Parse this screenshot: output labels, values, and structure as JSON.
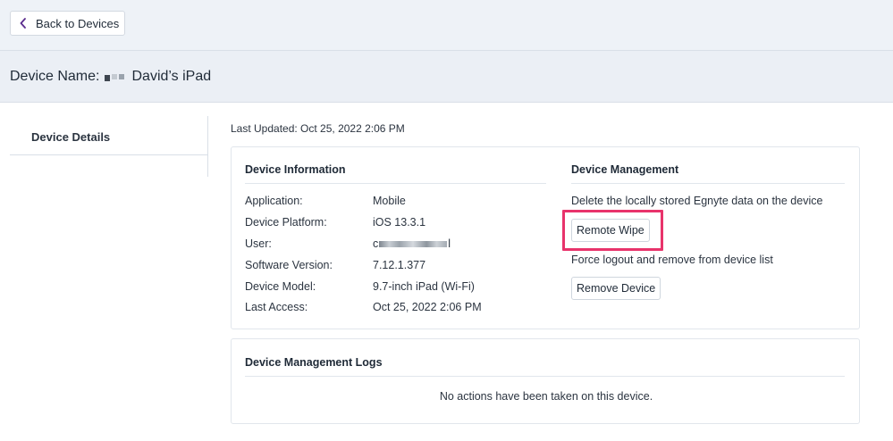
{
  "nav": {
    "back_label": "Back to Devices"
  },
  "header": {
    "device_name_label": "Device Name:",
    "device_name": "David’s iPad"
  },
  "sidebar": {
    "tabs": [
      {
        "label": "Device Details",
        "active": true
      }
    ]
  },
  "last_updated": "Last Updated: Oct 25, 2022 2:06 PM",
  "device_information": {
    "title": "Device Information",
    "rows": [
      {
        "label": "Application:",
        "value": "Mobile"
      },
      {
        "label": "Device Platform:",
        "value": "iOS 13.3.1"
      },
      {
        "label": "User:",
        "value_prefix": "c",
        "value_suffix": "l"
      },
      {
        "label": "Software Version:",
        "value": "7.12.1.377"
      },
      {
        "label": "Device Model:",
        "value": "9.7-inch iPad (Wi-Fi)"
      },
      {
        "label": "Last Access:",
        "value": "Oct 25, 2022 2:06 PM"
      }
    ]
  },
  "device_management": {
    "title": "Device Management",
    "wipe_description": "Delete the locally stored Egnyte data on the device",
    "wipe_button": "Remote Wipe",
    "remove_description": "Force logout and remove from device list",
    "remove_button": "Remove Device"
  },
  "logs": {
    "title": "Device Management Logs",
    "empty_message": "No actions have been taken on this device."
  },
  "colors": {
    "highlight": "#e8336b",
    "header_bg": "#ebeff5",
    "accent_chevron": "#5b2d8e"
  }
}
